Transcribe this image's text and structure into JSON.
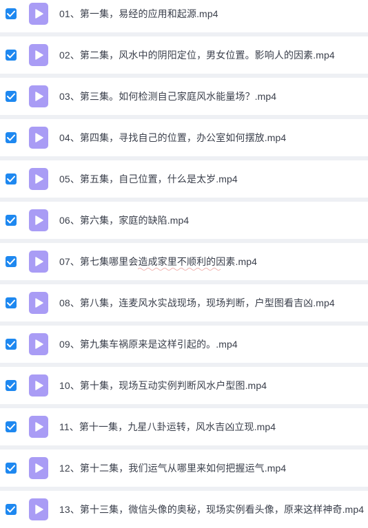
{
  "colors": {
    "checkbox": "#1e88f0",
    "file_icon": "#a99cf5",
    "row_bg": "#ffffff",
    "gap_bg": "#eef0f4",
    "text": "#3a3f4b"
  },
  "icons": {
    "checkbox": "check-icon",
    "file": "video-file-icon"
  },
  "files": [
    {
      "name": "01、第一集，易经的应用和起源.mp4",
      "checked": true
    },
    {
      "name": "02、第二集，风水中的阴阳定位，男女位置。影响人的因素.mp4",
      "checked": true
    },
    {
      "name": "03、第三集。如何检测自己家庭风水能量场？.mp4",
      "checked": true
    },
    {
      "name": "04、第四集，寻找自己的位置，办公室如何摆放.mp4",
      "checked": true
    },
    {
      "name": "05、第五集，自己位置，什么是太岁.mp4",
      "checked": true
    },
    {
      "name": "06、第六集，家庭的缺陷.mp4",
      "checked": true
    },
    {
      "name": "07、第七集哪里会造成家里不顺利的因素.mp4",
      "checked": true
    },
    {
      "name": "08、第八集，连麦风水实战现场，现场判断，户型图看吉凶.mp4",
      "checked": true
    },
    {
      "name": "09、第九集车祸原来是这样引起的。.mp4",
      "checked": true
    },
    {
      "name": "10、第十集，现场互动实例判断风水户型图.mp4",
      "checked": true
    },
    {
      "name": "11、第十一集，九星八卦运转，风水吉凶立现.mp4",
      "checked": true
    },
    {
      "name": "12、第十二集，我们运气从哪里来如何把握运气.mp4",
      "checked": true
    },
    {
      "name": "13、第十三集，微信头像的奥秘，现场实例看头像，原来这样神奇.mp4",
      "checked": true
    }
  ]
}
